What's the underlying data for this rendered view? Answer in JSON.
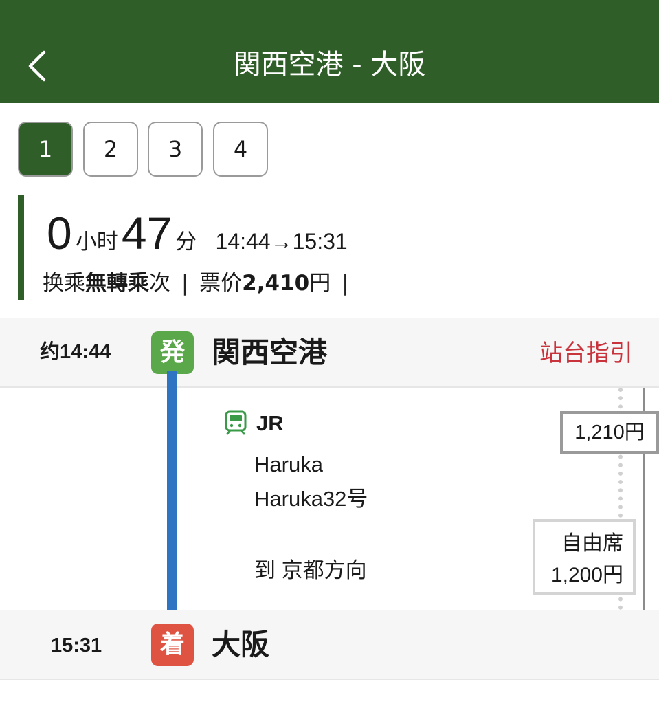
{
  "header": {
    "title": "関西空港 - 大阪"
  },
  "tabs": [
    {
      "label": "1",
      "active": true
    },
    {
      "label": "2",
      "active": false
    },
    {
      "label": "3",
      "active": false
    },
    {
      "label": "4",
      "active": false
    }
  ],
  "summary": {
    "hours": "0",
    "hours_unit": "小时",
    "minutes": "47",
    "minutes_unit": "分",
    "time_range": "14:44→15:31",
    "transfer_label": "换乘",
    "transfer_value": "無轉乘",
    "transfer_suffix": "次",
    "separator": "|",
    "fare_label": "票价",
    "fare_value": "2,410",
    "fare_unit": "円"
  },
  "departure": {
    "time": "约14:44",
    "badge": "発",
    "station": "関西空港",
    "guide_link": "站台指引"
  },
  "segment": {
    "operator": "JR",
    "train_name": "Haruka",
    "train_number": "Haruka32号",
    "direction": "到 京都方向",
    "fare": "1,210円",
    "seat_type": "自由席",
    "seat_fare": "1,200円"
  },
  "arrival": {
    "time": "15:31",
    "badge": "着",
    "station": "大阪"
  },
  "colors": {
    "header_bg": "#2f5e28",
    "depart_badge": "#5ba84a",
    "arrive_badge": "#df5343",
    "route_line": "#2f73c3",
    "guide_link": "#c8333c"
  },
  "icons": {
    "back": "chevron-left-icon",
    "train": "train-icon"
  }
}
